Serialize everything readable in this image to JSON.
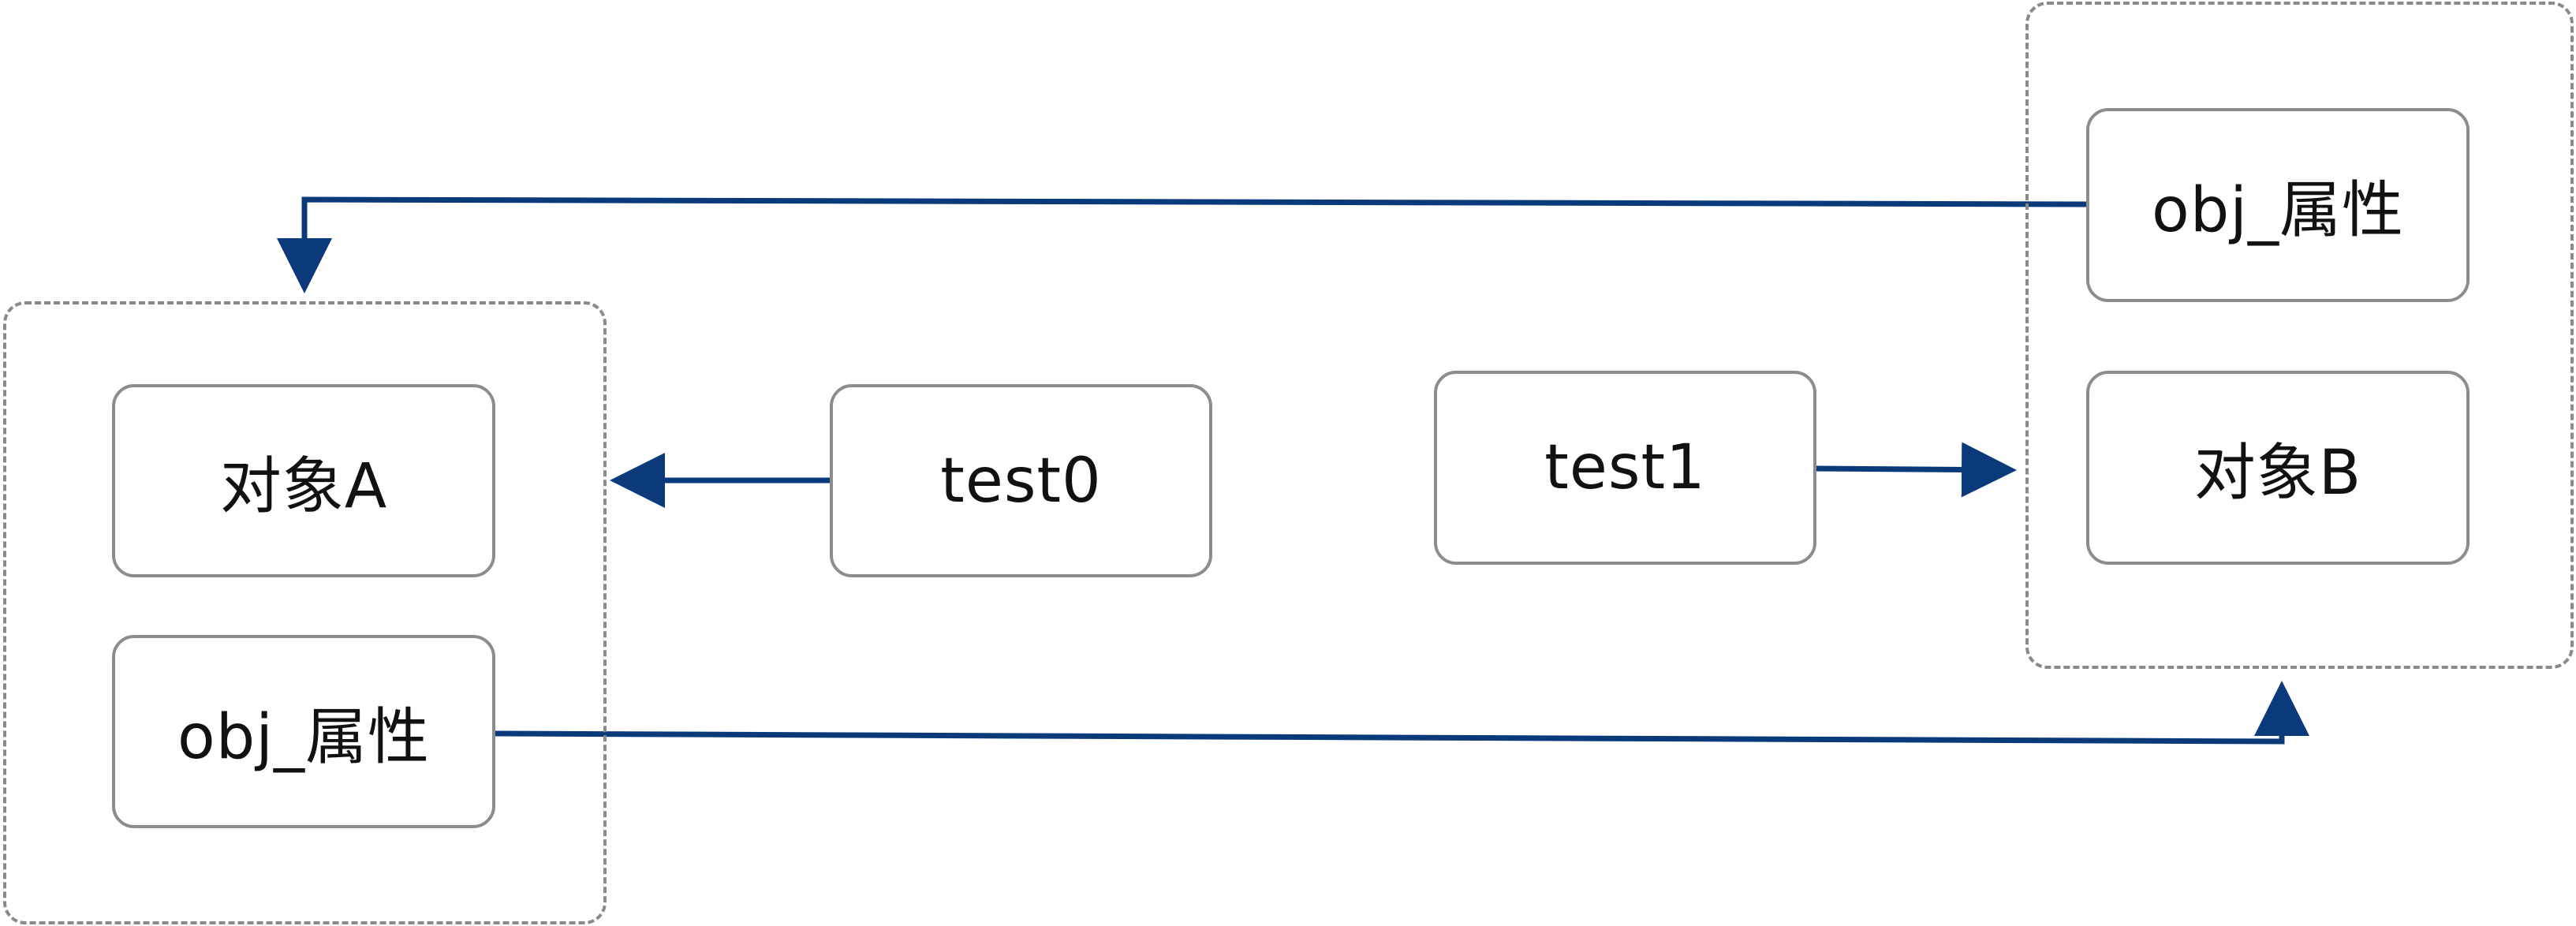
{
  "colors": {
    "edge": "#0b3a7a",
    "box_border": "#8c8c8c",
    "group_border": "#8a8a8a",
    "text": "#111111"
  },
  "groups": [
    {
      "id": "group-a",
      "nodes": [
        {
          "id": "object-a",
          "label": "对象A"
        },
        {
          "id": "obj-attr-a",
          "label": "obj_属性"
        }
      ]
    },
    {
      "id": "group-b",
      "nodes": [
        {
          "id": "obj-attr-b",
          "label": "obj_属性"
        },
        {
          "id": "object-b",
          "label": "对象B"
        }
      ]
    }
  ],
  "standalone_nodes": [
    {
      "id": "test0",
      "label": "test0"
    },
    {
      "id": "test1",
      "label": "test1"
    }
  ],
  "edges": [
    {
      "from": "test0",
      "to": "group-a"
    },
    {
      "from": "test1",
      "to": "group-b"
    },
    {
      "from": "obj-attr-b",
      "to": "group-a"
    },
    {
      "from": "obj-attr-a",
      "to": "group-b"
    }
  ]
}
